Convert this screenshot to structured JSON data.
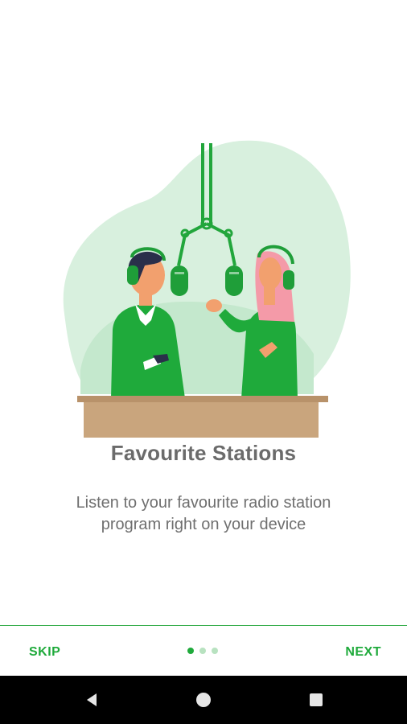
{
  "onboarding": {
    "title": "Favourite Stations",
    "description_line1": "Listen to your favourite radio station",
    "description_line2": "program right on your device",
    "illustration": "radio-hosts-studio-illustration"
  },
  "footer": {
    "skip_label": "SKIP",
    "next_label": "NEXT",
    "page_count": 3,
    "current_page": 1
  },
  "navbar": {
    "icons": [
      "back-icon",
      "home-icon",
      "recents-icon"
    ]
  },
  "colors": {
    "accent": "#1faa3b",
    "background_blob": "#d5efdc",
    "desk": "#c9a57d",
    "text": "#6b6b6b"
  }
}
